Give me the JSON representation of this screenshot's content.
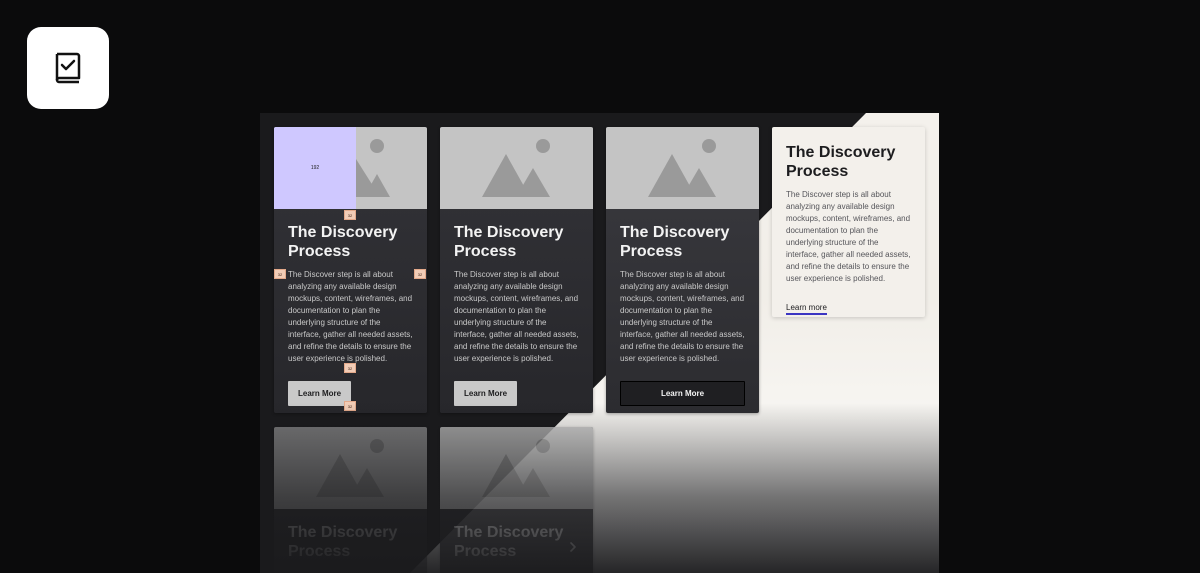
{
  "app_icon": {
    "name": "book-check-icon"
  },
  "cards": [
    {
      "title": "The Discovery Process",
      "description": "The Discover step is all about analyzing any available design mockups, content, wireframes, and documentation to plan the underlying structure of the interface, gather all needed assets, and refine the details to ensure the user experience is polished.",
      "button_label": "Learn More",
      "annotations": {
        "media_size": "192",
        "gap_top": "32",
        "pad_left": "32",
        "pad_right": "32",
        "gap_button_top": "32",
        "gap_button_bottom": "32"
      }
    },
    {
      "title": "The Discovery Process",
      "description": "The Discover step is all about analyzing any available design mockups, content, wireframes, and documentation to plan the underlying structure of the interface, gather all needed assets, and refine the details to ensure the user experience is polished.",
      "button_label": "Learn More"
    },
    {
      "title": "The Discovery Process",
      "description": "The Discover step is all about analyzing any available design mockups, content, wireframes, and documentation to plan the underlying structure of the interface, gather all needed assets, and refine the details to ensure the user experience is polished.",
      "button_label": "Learn More"
    },
    {
      "title": "The Discovery Process",
      "description": "The Discover step is all about analyzing any available design mockups, content, wireframes, and documentation to plan the underlying structure of the interface, gather all needed assets, and refine the details to ensure the user experience is polished.",
      "link_label": "Learn more"
    },
    {
      "title": "The Discovery Process"
    },
    {
      "title": "The Discovery Process",
      "icon": "chevron-right-icon"
    }
  ],
  "colors": {
    "accent_link_underline": "#3b35c2",
    "annotation_box": "#cfc8ff",
    "annotation_tag": "#f1ccb6"
  }
}
